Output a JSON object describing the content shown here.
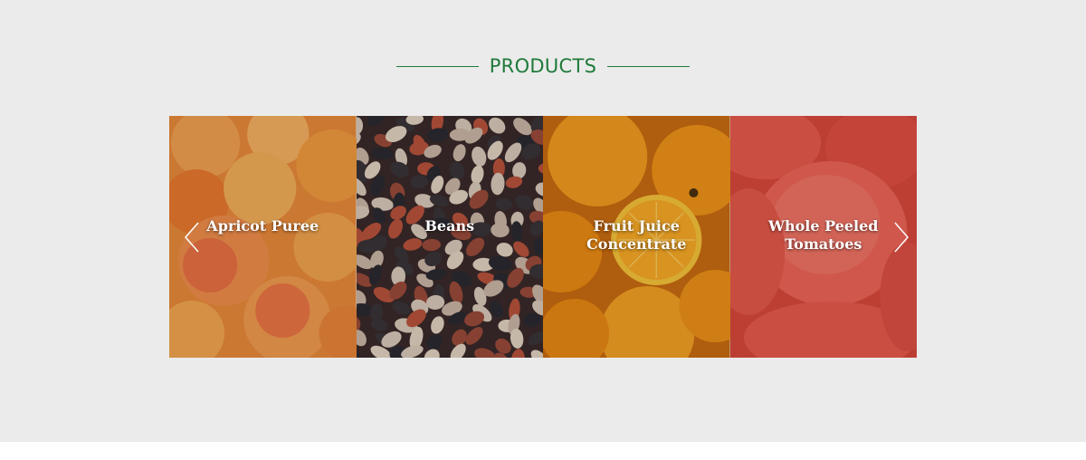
{
  "section": {
    "title": "PRODUCTS"
  },
  "products": [
    {
      "label": "Apricot Puree",
      "image": "apricots-photo"
    },
    {
      "label": "Beans",
      "image": "beans-photo"
    },
    {
      "label": "Fruit Juice\nConcentrate",
      "image": "oranges-photo"
    },
    {
      "label": "Whole Peeled\nTomatoes",
      "image": "tomatoes-photo"
    }
  ],
  "carousel": {
    "prev_icon": "chevron-left-icon",
    "next_icon": "chevron-right-icon"
  },
  "colors": {
    "accent": "#1f7a3a",
    "background": "#ebebeb",
    "label": "#ffffff"
  }
}
